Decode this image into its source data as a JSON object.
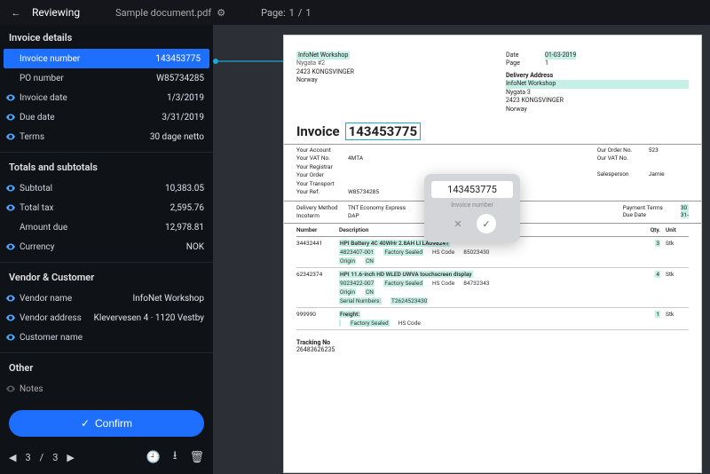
{
  "topbar": {
    "title": "Reviewing",
    "document_name": "Sample document.pdf",
    "page_label": "Page:",
    "page_current": "1",
    "page_sep": "/",
    "page_total": "1"
  },
  "panel": {
    "sections": {
      "invoice_details": {
        "title": "Invoice details",
        "fields": [
          {
            "label": "Invoice number",
            "value": "143453775",
            "active": true,
            "eye": false
          },
          {
            "label": "PO number",
            "value": "W85734285",
            "eye": false
          },
          {
            "label": "Invoice date",
            "value": "1/3/2019",
            "eye": true
          },
          {
            "label": "Due date",
            "value": "3/31/2019",
            "eye": true
          },
          {
            "label": "Terms",
            "value": "30 dage netto",
            "eye": true
          }
        ]
      },
      "totals": {
        "title": "Totals and subtotals",
        "fields": [
          {
            "label": "Subtotal",
            "value": "10,383.05",
            "eye": true
          },
          {
            "label": "Total tax",
            "value": "2,595.76",
            "eye": true
          },
          {
            "label": "Amount due",
            "value": "12,978.81",
            "eye": false
          },
          {
            "label": "Currency",
            "value": "NOK",
            "eye": true
          }
        ]
      },
      "vendor": {
        "title": "Vendor & Customer",
        "fields": [
          {
            "label": "Vendor name",
            "value": "InfoNet Workshop",
            "eye": true
          },
          {
            "label": "Vendor address",
            "value": "Klevervesen 4 · 1120 Vestby",
            "eye": true
          },
          {
            "label": "Customer name",
            "value": "",
            "eye": true
          }
        ]
      },
      "other": {
        "title": "Other",
        "fields": [
          {
            "label": "Notes",
            "value": "",
            "eye": true,
            "faded": true
          }
        ]
      }
    },
    "confirm_label": "Confirm",
    "pager": {
      "current": "3",
      "sep": "/",
      "total": "3"
    }
  },
  "popover": {
    "value": "143453775",
    "label": "Invoice number"
  },
  "invoice": {
    "header": {
      "company": "InfoNet Workshop",
      "city": "2423 KONGSVINGER",
      "country": "Norway",
      "date_k": "Date",
      "date_v": "01-03-2019",
      "page_k": "Page",
      "page_v": "1",
      "delivery_title": "Delivery Address",
      "del_line1": "InfoNet Workshop",
      "del_line2": "Nygata 3",
      "del_line3": "2423 KONGSVINGER",
      "del_line4": "Norway"
    },
    "title_word": "Invoice",
    "title_number": "143453775",
    "info": {
      "a": [
        {
          "k": "Your Account",
          "v": ""
        },
        {
          "k": "Your VAT No.",
          "v": "4MTA"
        },
        {
          "k": "Your Registrar",
          "v": ""
        },
        {
          "k": "Your Order",
          "v": ""
        },
        {
          "k": "Your Transport",
          "v": ""
        },
        {
          "k": "Your Ref.",
          "v": "W85734285"
        }
      ],
      "c": [
        {
          "k": "Our Order No.",
          "v": "523"
        },
        {
          "k": "Our VAT No.",
          "v": ""
        },
        {
          "k": "Salesperson",
          "v": "Jamie"
        }
      ]
    },
    "delivery": {
      "method_k": "Delivery Method",
      "method_v": "TNT Economy Express",
      "incoterm_k": "Incoterm",
      "incoterm_v": "DAP",
      "payterms_k": "Payment Terms",
      "payterms_v": "30",
      "due_k": "Due Date",
      "due_v": "31-"
    },
    "table": {
      "head": {
        "num": "Number",
        "desc": "Description",
        "qty": "Qty.",
        "unit": "Unit"
      },
      "rows": [
        {
          "num": "34432441",
          "desc": "HPI Battery 4C 40WHr 2.8AH LI LA098241",
          "sub": [
            {
              "k": "4823407-001",
              "v": "Factory Sealed",
              "k2": "HS Code",
              "v2": "85023430"
            },
            {
              "k": "Origin",
              "v": "CN"
            }
          ],
          "qty": "3",
          "unit": "Stk"
        },
        {
          "num": "62342374",
          "desc": "HPI 11.6-inch HD WLED UWVA touchscreen display",
          "sub": [
            {
              "k": "9023422-007",
              "v": "Factory Sealed",
              "k2": "HS Code",
              "v2": "84732343"
            },
            {
              "k": "Origin",
              "v": "CN"
            },
            {
              "k": "Serial Numbers:",
              "v": "T2624523430"
            }
          ],
          "qty": "4",
          "unit": "Stk"
        },
        {
          "num": "999990",
          "desc": "Freight:",
          "sub": [
            {
              "k": "",
              "v": "Factory Sealed",
              "k2": "HS Code",
              "v2": ""
            }
          ],
          "qty": "1",
          "unit": "Stk"
        }
      ]
    },
    "tracking_k": "Tracking No",
    "tracking_v": "26483626235"
  }
}
